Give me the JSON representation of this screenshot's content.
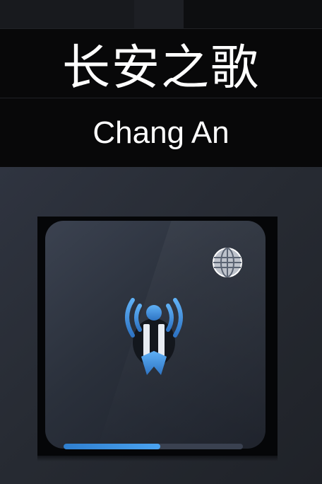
{
  "banner": {
    "title_cn": "长安之歌",
    "title_en": "Chang An"
  },
  "tile": {
    "icon": "radio-broadcast-icon",
    "globe_icon": "globe-icon",
    "progress": 0.54,
    "accent": "#3d8fe0"
  }
}
